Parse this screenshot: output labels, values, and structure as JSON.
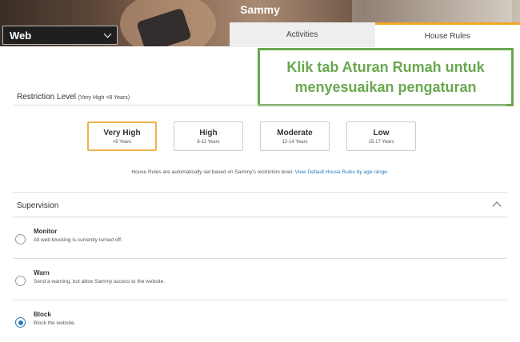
{
  "header": {
    "child_name": "Sammy",
    "platform_select": "Web"
  },
  "tabs": [
    {
      "label": "Activities",
      "active": false
    },
    {
      "label": "House Rules",
      "active": true
    }
  ],
  "callout": {
    "line1": "Klik tab Aturan Rumah untuk",
    "line2": "menyesuaikan pengaturan"
  },
  "restriction": {
    "title": "Restriction Level",
    "current": "(Very High <8 Years)",
    "levels": [
      {
        "name": "Very High",
        "age": "<8 Years",
        "selected": true
      },
      {
        "name": "High",
        "age": "8-11 Years",
        "selected": false
      },
      {
        "name": "Moderate",
        "age": "12-14 Years",
        "selected": false
      },
      {
        "name": "Low",
        "age": "15-17 Years",
        "selected": false
      }
    ],
    "note": "House Rules are automatically set based on Sammy's restriction level.",
    "note_link": "View Default House Rules by age range."
  },
  "supervision": {
    "title": "Supervision",
    "options": [
      {
        "name": "Monitor",
        "desc": "All web blocking is currently turned off.",
        "checked": false
      },
      {
        "name": "Warn",
        "desc": "Send a warning, but allow Sammy access to the website.",
        "checked": false
      },
      {
        "name": "Block",
        "desc": "Block the website.",
        "checked": true
      }
    ]
  },
  "colors": {
    "accent_orange": "#f5a623",
    "callout_green": "#6aa84f",
    "link_blue": "#2a7ab8"
  }
}
